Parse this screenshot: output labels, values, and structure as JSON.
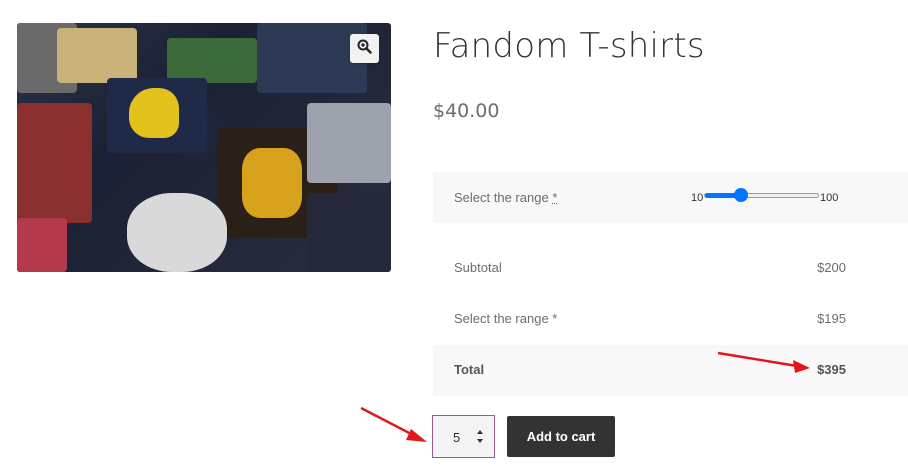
{
  "product": {
    "title": "Fandom T-shirts",
    "price": "$40.00",
    "image_alt": "Pile of fandom t-shirts"
  },
  "range_field": {
    "label": "Select the range",
    "required_mark": "*",
    "min_label": "10",
    "max_label": "100",
    "min": 10,
    "max": 100,
    "value": 39
  },
  "summary": {
    "rows": [
      {
        "label": "Subtotal",
        "value": "$200"
      },
      {
        "label": "Select the range *",
        "value": "$195"
      }
    ],
    "total": {
      "label": "Total",
      "value": "$395"
    }
  },
  "cart": {
    "quantity": "5",
    "add_to_cart_label": "Add to cart"
  },
  "icons": {
    "zoom": "zoom-in-icon",
    "spinner": "spinner-arrows-icon"
  },
  "colors": {
    "accent": "#0075ff",
    "button": "#333333",
    "annotation_arrow": "#e3161b"
  }
}
